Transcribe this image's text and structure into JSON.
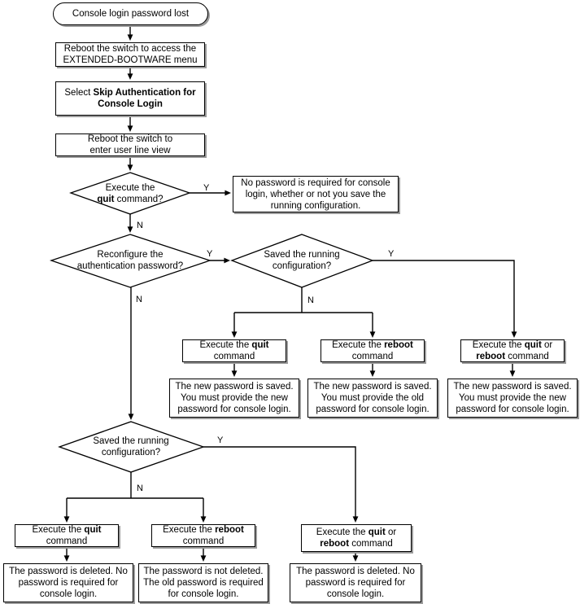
{
  "diagram": {
    "title": "Console login password lost recovery flowchart",
    "colors": {
      "stroke": "#000000",
      "shadow": "#9a9a9a",
      "background": "#ffffff",
      "text": "#000000"
    },
    "nodes": {
      "start": {
        "shape": "terminal",
        "text": "Console login password lost"
      },
      "step_reboot_bootware": {
        "shape": "process",
        "text": "Reboot the switch to access the\nEXTENDED-BOOTWARE menu"
      },
      "step_select_skip": {
        "shape": "process",
        "text_prefix": "Select ",
        "text_bold": "Skip Authentication for\nConsole Login"
      },
      "step_reboot_userline": {
        "shape": "process",
        "text": "Reboot the switch to\nenter user line view"
      },
      "decision_quit": {
        "shape": "decision",
        "line1": "Execute the",
        "bold": "quit",
        "line2_suffix": " command?"
      },
      "result_no_password": {
        "shape": "process",
        "text": "No password is required for console\nlogin, whether or not you save the\nrunning configuration."
      },
      "decision_reconfigure": {
        "shape": "decision",
        "text": "Reconfigure the\nauthentication password?"
      },
      "decision_saved_upper": {
        "shape": "decision",
        "text": "Saved the running\nconfiguration?"
      },
      "decision_saved_lower": {
        "shape": "decision",
        "text": "Saved the running\nconfiguration?"
      },
      "mid_exec_quit": {
        "shape": "process",
        "prefix": "Execute the ",
        "bold": "quit",
        "suffix": "\ncommand"
      },
      "mid_exec_reboot": {
        "shape": "process",
        "prefix": "Execute the ",
        "bold": "reboot",
        "suffix": "\ncommand"
      },
      "mid_exec_quit_or_reboot": {
        "shape": "process",
        "prefix": "Execute the ",
        "bold1": "quit",
        "mid": " or\n",
        "bold2": "reboot",
        "suffix": " command"
      },
      "mid_result_new_new": {
        "shape": "process",
        "text": "The new password is saved.\nYou must provide the new\npassword for console login."
      },
      "mid_result_new_old": {
        "shape": "process",
        "text": "The new password is saved.\nYou must provide the old\npassword for console login."
      },
      "mid_result_new_new_right": {
        "shape": "process",
        "text": "The new password is saved.\nYou must provide the new\npassword for console login."
      },
      "bot_exec_quit": {
        "shape": "process",
        "prefix": "Execute the ",
        "bold": "quit",
        "suffix": "\ncommand"
      },
      "bot_exec_reboot": {
        "shape": "process",
        "prefix": "Execute the ",
        "bold": "reboot",
        "suffix": "\ncommand"
      },
      "bot_exec_quit_or_reboot": {
        "shape": "process",
        "prefix": "Execute the ",
        "bold1": "quit",
        "mid": " or\n",
        "bold2": "reboot",
        "suffix": " command"
      },
      "bot_result_deleted": {
        "shape": "process",
        "text": "The password is deleted. No\npassword is required for\nconsole login."
      },
      "bot_result_not_deleted": {
        "shape": "process",
        "text": "The password is not deleted.\nThe old password is required\nfor console login."
      },
      "bot_result_deleted_right": {
        "shape": "process",
        "text": "The password is deleted. No\npassword is required for\nconsole login."
      }
    },
    "edge_labels": {
      "quit_yes": "Y",
      "quit_no": "N",
      "reconfigure_yes": "Y",
      "reconfigure_no": "N",
      "saved_upper_yes": "Y",
      "saved_upper_no": "N",
      "saved_lower_yes": "Y",
      "saved_lower_no": "N"
    }
  }
}
